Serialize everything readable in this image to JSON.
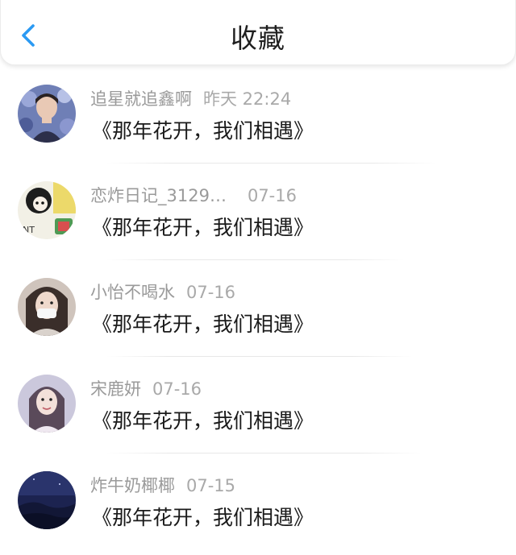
{
  "header": {
    "title": "收藏",
    "back_icon": "chevron-left-icon",
    "accent_color": "#2b9af3"
  },
  "items": [
    {
      "name": "追星就追鑫啊",
      "time": "昨天 22:24",
      "content": "《那年花开，我们相遇》"
    },
    {
      "name": "恋炸日记_3129…",
      "time": "07-16",
      "content": "《那年花开，我们相遇》"
    },
    {
      "name": "小怡不喝水",
      "time": "07-16",
      "content": "《那年花开，我们相遇》"
    },
    {
      "name": "宋鹿妍",
      "time": "07-16",
      "content": "《那年花开，我们相遇》"
    },
    {
      "name": "炸牛奶椰椰",
      "time": "07-15",
      "content": "《那年花开，我们相遇》"
    }
  ]
}
